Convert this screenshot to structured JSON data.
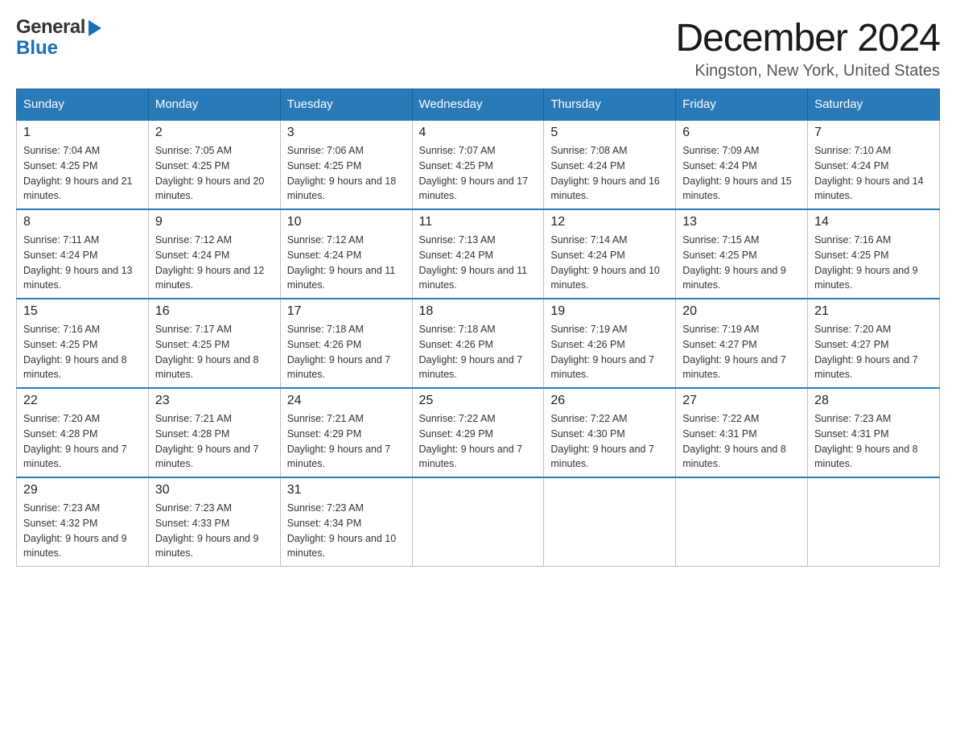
{
  "header": {
    "month_title": "December 2024",
    "location": "Kingston, New York, United States"
  },
  "logo": {
    "general": "General",
    "blue": "Blue"
  },
  "days_of_week": [
    "Sunday",
    "Monday",
    "Tuesday",
    "Wednesday",
    "Thursday",
    "Friday",
    "Saturday"
  ],
  "weeks": [
    [
      {
        "day": "1",
        "sunrise": "7:04 AM",
        "sunset": "4:25 PM",
        "daylight": "9 hours and 21 minutes."
      },
      {
        "day": "2",
        "sunrise": "7:05 AM",
        "sunset": "4:25 PM",
        "daylight": "9 hours and 20 minutes."
      },
      {
        "day": "3",
        "sunrise": "7:06 AM",
        "sunset": "4:25 PM",
        "daylight": "9 hours and 18 minutes."
      },
      {
        "day": "4",
        "sunrise": "7:07 AM",
        "sunset": "4:25 PM",
        "daylight": "9 hours and 17 minutes."
      },
      {
        "day": "5",
        "sunrise": "7:08 AM",
        "sunset": "4:24 PM",
        "daylight": "9 hours and 16 minutes."
      },
      {
        "day": "6",
        "sunrise": "7:09 AM",
        "sunset": "4:24 PM",
        "daylight": "9 hours and 15 minutes."
      },
      {
        "day": "7",
        "sunrise": "7:10 AM",
        "sunset": "4:24 PM",
        "daylight": "9 hours and 14 minutes."
      }
    ],
    [
      {
        "day": "8",
        "sunrise": "7:11 AM",
        "sunset": "4:24 PM",
        "daylight": "9 hours and 13 minutes."
      },
      {
        "day": "9",
        "sunrise": "7:12 AM",
        "sunset": "4:24 PM",
        "daylight": "9 hours and 12 minutes."
      },
      {
        "day": "10",
        "sunrise": "7:12 AM",
        "sunset": "4:24 PM",
        "daylight": "9 hours and 11 minutes."
      },
      {
        "day": "11",
        "sunrise": "7:13 AM",
        "sunset": "4:24 PM",
        "daylight": "9 hours and 11 minutes."
      },
      {
        "day": "12",
        "sunrise": "7:14 AM",
        "sunset": "4:24 PM",
        "daylight": "9 hours and 10 minutes."
      },
      {
        "day": "13",
        "sunrise": "7:15 AM",
        "sunset": "4:25 PM",
        "daylight": "9 hours and 9 minutes."
      },
      {
        "day": "14",
        "sunrise": "7:16 AM",
        "sunset": "4:25 PM",
        "daylight": "9 hours and 9 minutes."
      }
    ],
    [
      {
        "day": "15",
        "sunrise": "7:16 AM",
        "sunset": "4:25 PM",
        "daylight": "9 hours and 8 minutes."
      },
      {
        "day": "16",
        "sunrise": "7:17 AM",
        "sunset": "4:25 PM",
        "daylight": "9 hours and 8 minutes."
      },
      {
        "day": "17",
        "sunrise": "7:18 AM",
        "sunset": "4:26 PM",
        "daylight": "9 hours and 7 minutes."
      },
      {
        "day": "18",
        "sunrise": "7:18 AM",
        "sunset": "4:26 PM",
        "daylight": "9 hours and 7 minutes."
      },
      {
        "day": "19",
        "sunrise": "7:19 AM",
        "sunset": "4:26 PM",
        "daylight": "9 hours and 7 minutes."
      },
      {
        "day": "20",
        "sunrise": "7:19 AM",
        "sunset": "4:27 PM",
        "daylight": "9 hours and 7 minutes."
      },
      {
        "day": "21",
        "sunrise": "7:20 AM",
        "sunset": "4:27 PM",
        "daylight": "9 hours and 7 minutes."
      }
    ],
    [
      {
        "day": "22",
        "sunrise": "7:20 AM",
        "sunset": "4:28 PM",
        "daylight": "9 hours and 7 minutes."
      },
      {
        "day": "23",
        "sunrise": "7:21 AM",
        "sunset": "4:28 PM",
        "daylight": "9 hours and 7 minutes."
      },
      {
        "day": "24",
        "sunrise": "7:21 AM",
        "sunset": "4:29 PM",
        "daylight": "9 hours and 7 minutes."
      },
      {
        "day": "25",
        "sunrise": "7:22 AM",
        "sunset": "4:29 PM",
        "daylight": "9 hours and 7 minutes."
      },
      {
        "day": "26",
        "sunrise": "7:22 AM",
        "sunset": "4:30 PM",
        "daylight": "9 hours and 7 minutes."
      },
      {
        "day": "27",
        "sunrise": "7:22 AM",
        "sunset": "4:31 PM",
        "daylight": "9 hours and 8 minutes."
      },
      {
        "day": "28",
        "sunrise": "7:23 AM",
        "sunset": "4:31 PM",
        "daylight": "9 hours and 8 minutes."
      }
    ],
    [
      {
        "day": "29",
        "sunrise": "7:23 AM",
        "sunset": "4:32 PM",
        "daylight": "9 hours and 9 minutes."
      },
      {
        "day": "30",
        "sunrise": "7:23 AM",
        "sunset": "4:33 PM",
        "daylight": "9 hours and 9 minutes."
      },
      {
        "day": "31",
        "sunrise": "7:23 AM",
        "sunset": "4:34 PM",
        "daylight": "9 hours and 10 minutes."
      },
      null,
      null,
      null,
      null
    ]
  ],
  "labels": {
    "sunrise": "Sunrise:",
    "sunset": "Sunset:",
    "daylight": "Daylight:"
  }
}
